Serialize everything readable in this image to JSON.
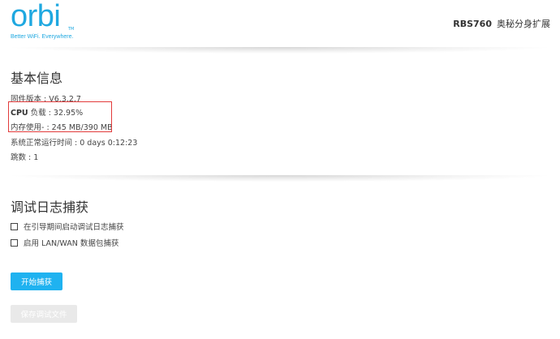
{
  "header": {
    "logo": {
      "word": "orbi",
      "tm": "TM",
      "tagline": "Better WiFi. Everywhere."
    },
    "model_code": "RBS760",
    "model_desc": "奥秘分身扩展"
  },
  "basic_info": {
    "title": "基本信息",
    "firmware": "固件版本 : V6.3.2.7",
    "cpu_label": "CPU",
    "cpu_value": " 负载 : 32.95%",
    "memory": "内存使用- : 245 MB/390 MB",
    "uptime": "系统正常运行时间 : 0 days 0:12:23",
    "hops": "跳数 : 1"
  },
  "debug_capture": {
    "title": "调试日志捕获",
    "option_boot": "在引导期间启动调试日志捕获",
    "option_lanwan": "启用 LAN/WAN 数据包捕获",
    "start_button": "开始捕获",
    "save_button": "保存调试文件"
  },
  "colors": {
    "brand": "#1fa8e0",
    "button_primary": "#1fb2f0",
    "highlight_border": "#e23b3b"
  }
}
